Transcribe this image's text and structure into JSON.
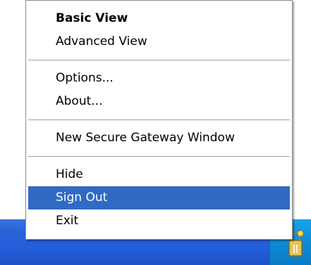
{
  "menu": {
    "items": [
      {
        "label": "Basic View"
      },
      {
        "label": "Advanced View"
      },
      {
        "label": "Options..."
      },
      {
        "label": "About..."
      },
      {
        "label": "New Secure Gateway Window"
      },
      {
        "label": "Hide"
      },
      {
        "label": "Sign Out"
      },
      {
        "label": "Exit"
      }
    ],
    "highlight_color": "#316ac5"
  },
  "taskbar": {
    "color": "#245edb",
    "tray_color": "#0f8bd6",
    "tray_icon": "secure-gateway-lock-icon"
  }
}
